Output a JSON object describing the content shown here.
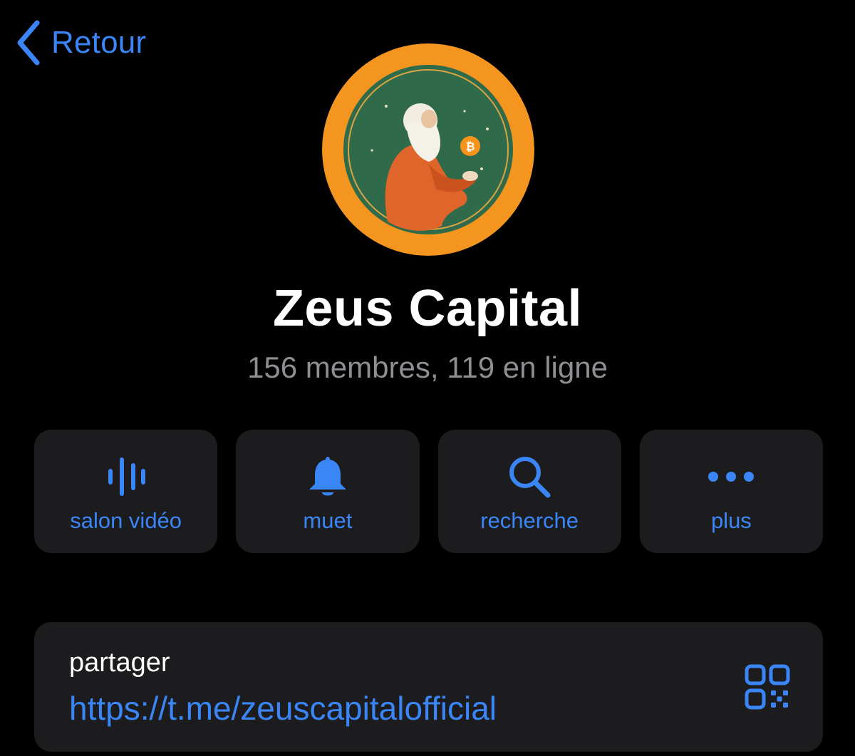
{
  "nav": {
    "back_label": "Retour",
    "back_icon": "chevron-left-icon"
  },
  "profile": {
    "avatar_alt": "Zeus Capital",
    "name": "Zeus Capital",
    "members_status": "156 membres, 119 en ligne"
  },
  "actions": [
    {
      "label": "salon vidéo",
      "icon": "voice-chat-icon"
    },
    {
      "label": "muet",
      "icon": "bell-icon"
    },
    {
      "label": "recherche",
      "icon": "search-icon"
    },
    {
      "label": "plus",
      "icon": "more-icon"
    }
  ],
  "share": {
    "title": "partager",
    "link": "https://t.me/zeuscapitalofficial",
    "qr_icon": "qr-code-icon"
  },
  "colors": {
    "background": "#000000",
    "card": "#1c1c1e",
    "accent": "#3b86f7",
    "secondary_text": "#8e8e93",
    "avatar_ring": "#f4951f",
    "avatar_inner": "#2f6b4b"
  }
}
